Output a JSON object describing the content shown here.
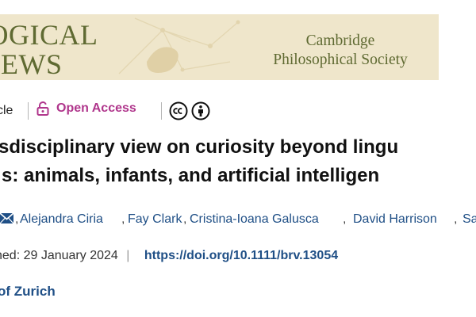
{
  "banner": {
    "journal_title_line1": "LOGICAL",
    "journal_title_line2": "VIEWS",
    "society_line1": "Cambridge",
    "society_line2": "Philosophical Society",
    "background_color": "#efe6cb",
    "text_color": "#5f6a32"
  },
  "article_meta": {
    "type_label": "cle",
    "open_access_label": "Open Access",
    "open_access_color": "#b0368c",
    "license_icons": [
      "cc-icon",
      "by-icon"
    ]
  },
  "article": {
    "title_line1": "sdisciplinary view on curiosity beyond lingu",
    "title_line2": "s: animals, infants, and artificial intelligen"
  },
  "authors": {
    "email_icon": "email-icon",
    "list": [
      "Alejandra Ciria",
      "Fay Clark",
      "Cristina-Ioana Galusca",
      "David Harrison",
      "Sa"
    ],
    "link_color": "#1f4f86"
  },
  "publication": {
    "published_label": "hed:",
    "published_date": "29 January 2024",
    "separator": "|",
    "doi_link": "https://doi.org/10.1111/brv.13054"
  },
  "affiliation": {
    "institution_text": "of Zurich"
  }
}
